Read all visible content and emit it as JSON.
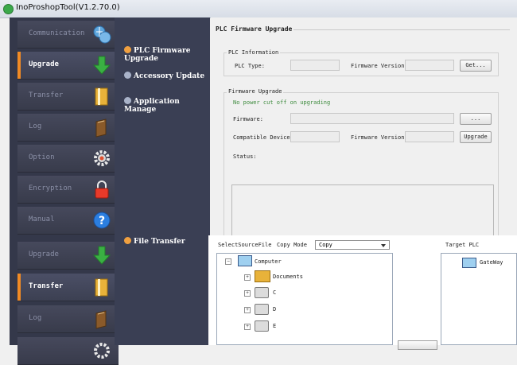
{
  "window": {
    "title": "InoProshopTool(V1.2.70.0)"
  },
  "nav_top": [
    {
      "label": "Communication",
      "icon": "globe-icon",
      "active": false
    },
    {
      "label": "Upgrade",
      "icon": "download-arrow-icon",
      "active": true
    },
    {
      "label": "Transfer",
      "icon": "book-icon",
      "active": false
    },
    {
      "label": "Log",
      "icon": "notebook-icon",
      "active": false
    },
    {
      "label": "Option",
      "icon": "gear-icon",
      "active": false
    },
    {
      "label": "Encryption",
      "icon": "lock-icon",
      "active": false
    },
    {
      "label": "Manual",
      "icon": "help-icon",
      "active": false
    }
  ],
  "nav_bottom": [
    {
      "label": "Upgrade",
      "icon": "download-arrow-icon",
      "active": false
    },
    {
      "label": "Transfer",
      "icon": "book-icon",
      "active": true
    },
    {
      "label": "Log",
      "icon": "notebook-icon",
      "active": false
    }
  ],
  "upgrade_options": [
    {
      "label": "PLC Firmware Upgrade",
      "selected": true
    },
    {
      "label": "Accessory Update",
      "selected": false
    },
    {
      "label": "Application Manage",
      "selected": false
    }
  ],
  "transfer_options": [
    {
      "label": "File Transfer",
      "selected": true
    }
  ],
  "panel": {
    "title": "PLC Firmware Upgrade",
    "plc_info": {
      "legend": "PLC Information",
      "plc_type_label": "PLC Type:",
      "plc_type_value": "",
      "fw_version_label": "Firmware Version:",
      "fw_version_value": "",
      "get_button": "Get..."
    },
    "fw_upgrade": {
      "legend": "Firmware Upgrade",
      "warning": "No power cut off on upgrading",
      "firmware_label": "Firmware:",
      "firmware_value": "",
      "browse_button": "...",
      "compat_label": "Compatible Device:",
      "compat_value": "",
      "fw_version_label": "Firmware Version:",
      "fw_version_value": "",
      "upgrade_button": "Upgrade",
      "status_label": "Status:"
    }
  },
  "file_transfer": {
    "select_source_label": "SelectSourceFile",
    "copy_mode_label": "Copy Mode",
    "copy_mode_value": "Copy",
    "target_plc_label": "Target PLC",
    "tree": [
      {
        "label": "Computer",
        "icon": "computer-icon"
      },
      {
        "label": "Documents",
        "icon": "folder-icon"
      },
      {
        "label": "C",
        "icon": "drive-icon"
      },
      {
        "label": "D",
        "icon": "drive-icon"
      },
      {
        "label": "E",
        "icon": "drive-icon"
      }
    ],
    "target_tree": [
      {
        "label": "GateWay",
        "icon": "monitor-icon"
      }
    ]
  },
  "colors": {
    "accent": "#f08a24",
    "nav_bg": "#34384a",
    "sidebar_bg": "#3a3f54"
  }
}
